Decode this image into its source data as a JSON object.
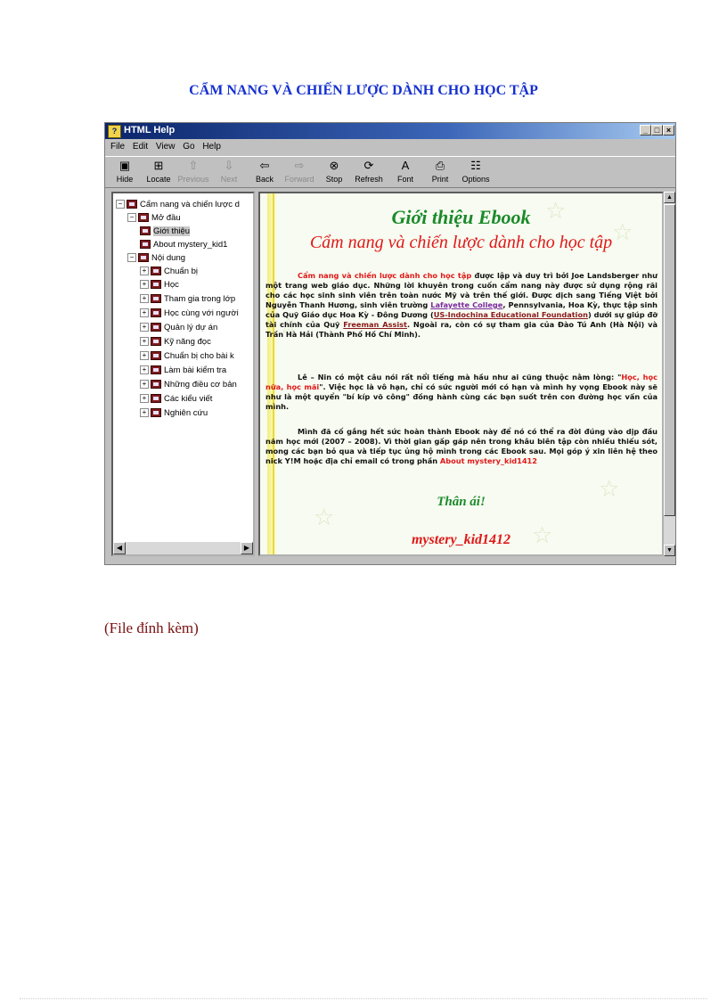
{
  "doc": {
    "title": "CẨM NANG VÀ CHIẾN LƯỢC DÀNH CHO HỌC TẬP",
    "attachment": "(File  đính kèm)"
  },
  "window": {
    "title": "HTML Help",
    "controls": [
      "_",
      "□",
      "×"
    ],
    "menu": [
      "File",
      "Edit",
      "View",
      "Go",
      "Help"
    ],
    "toolbar": [
      {
        "label": "Hide",
        "icon": "hide-icon",
        "enabled": true
      },
      {
        "label": "Locate",
        "icon": "locate-icon",
        "enabled": true
      },
      {
        "label": "Previous",
        "icon": "up-arrow-icon",
        "enabled": false
      },
      {
        "label": "Next",
        "icon": "down-arrow-icon",
        "enabled": false
      },
      {
        "label": "Back",
        "icon": "back-arrow-icon",
        "enabled": true
      },
      {
        "label": "Forward",
        "icon": "forward-arrow-icon",
        "enabled": false
      },
      {
        "label": "Stop",
        "icon": "stop-icon",
        "enabled": true
      },
      {
        "label": "Refresh",
        "icon": "refresh-icon",
        "enabled": true
      },
      {
        "label": "Font",
        "icon": "font-icon",
        "enabled": true
      },
      {
        "label": "Print",
        "icon": "print-icon",
        "enabled": true
      },
      {
        "label": "Options",
        "icon": "options-icon",
        "enabled": true
      }
    ]
  },
  "tree": {
    "root": "Cẩm nang và chiến lược d",
    "section1": "Mở đầu",
    "intro": "Giới thiệu",
    "about": "About mystery_kid1",
    "section2": "Nội dung",
    "items": [
      "Chuẩn bị",
      "Học",
      "Tham gia trong lớp",
      "Học cùng với người",
      "Quản lý dự án",
      "Kỹ năng đọc",
      "Chuẩn bị cho bài k",
      "Làm bài kiểm tra",
      "Những điều cơ bản",
      "Các kiểu viết",
      "Nghiên cứu"
    ]
  },
  "content": {
    "heading1": "Giới thiệu Ebook",
    "heading2": "Cẩm nang và chiến lược dành cho học tập",
    "p1": {
      "lead": "Cẩm nang và chiến lược dành cho học tập",
      "t1": " được lập và duy trì bởi Joe Landsberger như một trang web giáo dục. Những lời khuyên trong cuốn cẩm nang này được sử dụng rộng rãi cho các học sinh sinh viên trên toàn nước Mỹ và trên thế giới. Được dịch sang Tiếng Việt bởi Nguyễn Thanh Hương, sinh viên trường ",
      "link1": "Lafayette College",
      "t2": ", Pennsylvania, Hoa Kỳ, thực tập sinh của Quỹ Giáo dục Hoa Kỳ - Đông Dương (",
      "link2": "US-Indochina Educational Foundation",
      "t3": ") dưới sự giúp đỡ tài chính của Quỹ ",
      "link3": "Freeman Assist",
      "t4": ". Ngoài ra, còn có sự tham gia của Đào Tú Anh (Hà Nội) và Trần Hà Hải (Thành Phố Hồ Chí Minh)."
    },
    "p2": {
      "t1": "Lê – Nin có một câu nói rất nổi tiếng mà hầu như ai cũng thuộc nằm lòng: \"",
      "quote": "Học, học nữa, học mãi",
      "t2": "\". Việc học là vô hạn, chỉ có sức người mới có hạn và mình hy vọng Ebook này sẽ như là một quyển \"bí kíp võ công\" đồng hành cùng các bạn suốt trên con đường học vấn của mình."
    },
    "p3": {
      "t1": "Mình đã cố gắng hết sức hoàn thành Ebook này để nó có thể ra đời đúng vào dịp đầu năm học mới (2007 – 2008). Vì thời gian gấp gáp nên trong khâu biên tập còn nhiều thiếu sót, mong các bạn bỏ qua và tiếp tục ủng hộ mình trong các Ebook sau. Mọi góp ý xin liên hệ theo nick Y!M hoặc địa chỉ email có trong phần ",
      "link": "About mystery_kid1412"
    },
    "thanks": "Thân ái!",
    "signature": "mystery_kid1412"
  }
}
